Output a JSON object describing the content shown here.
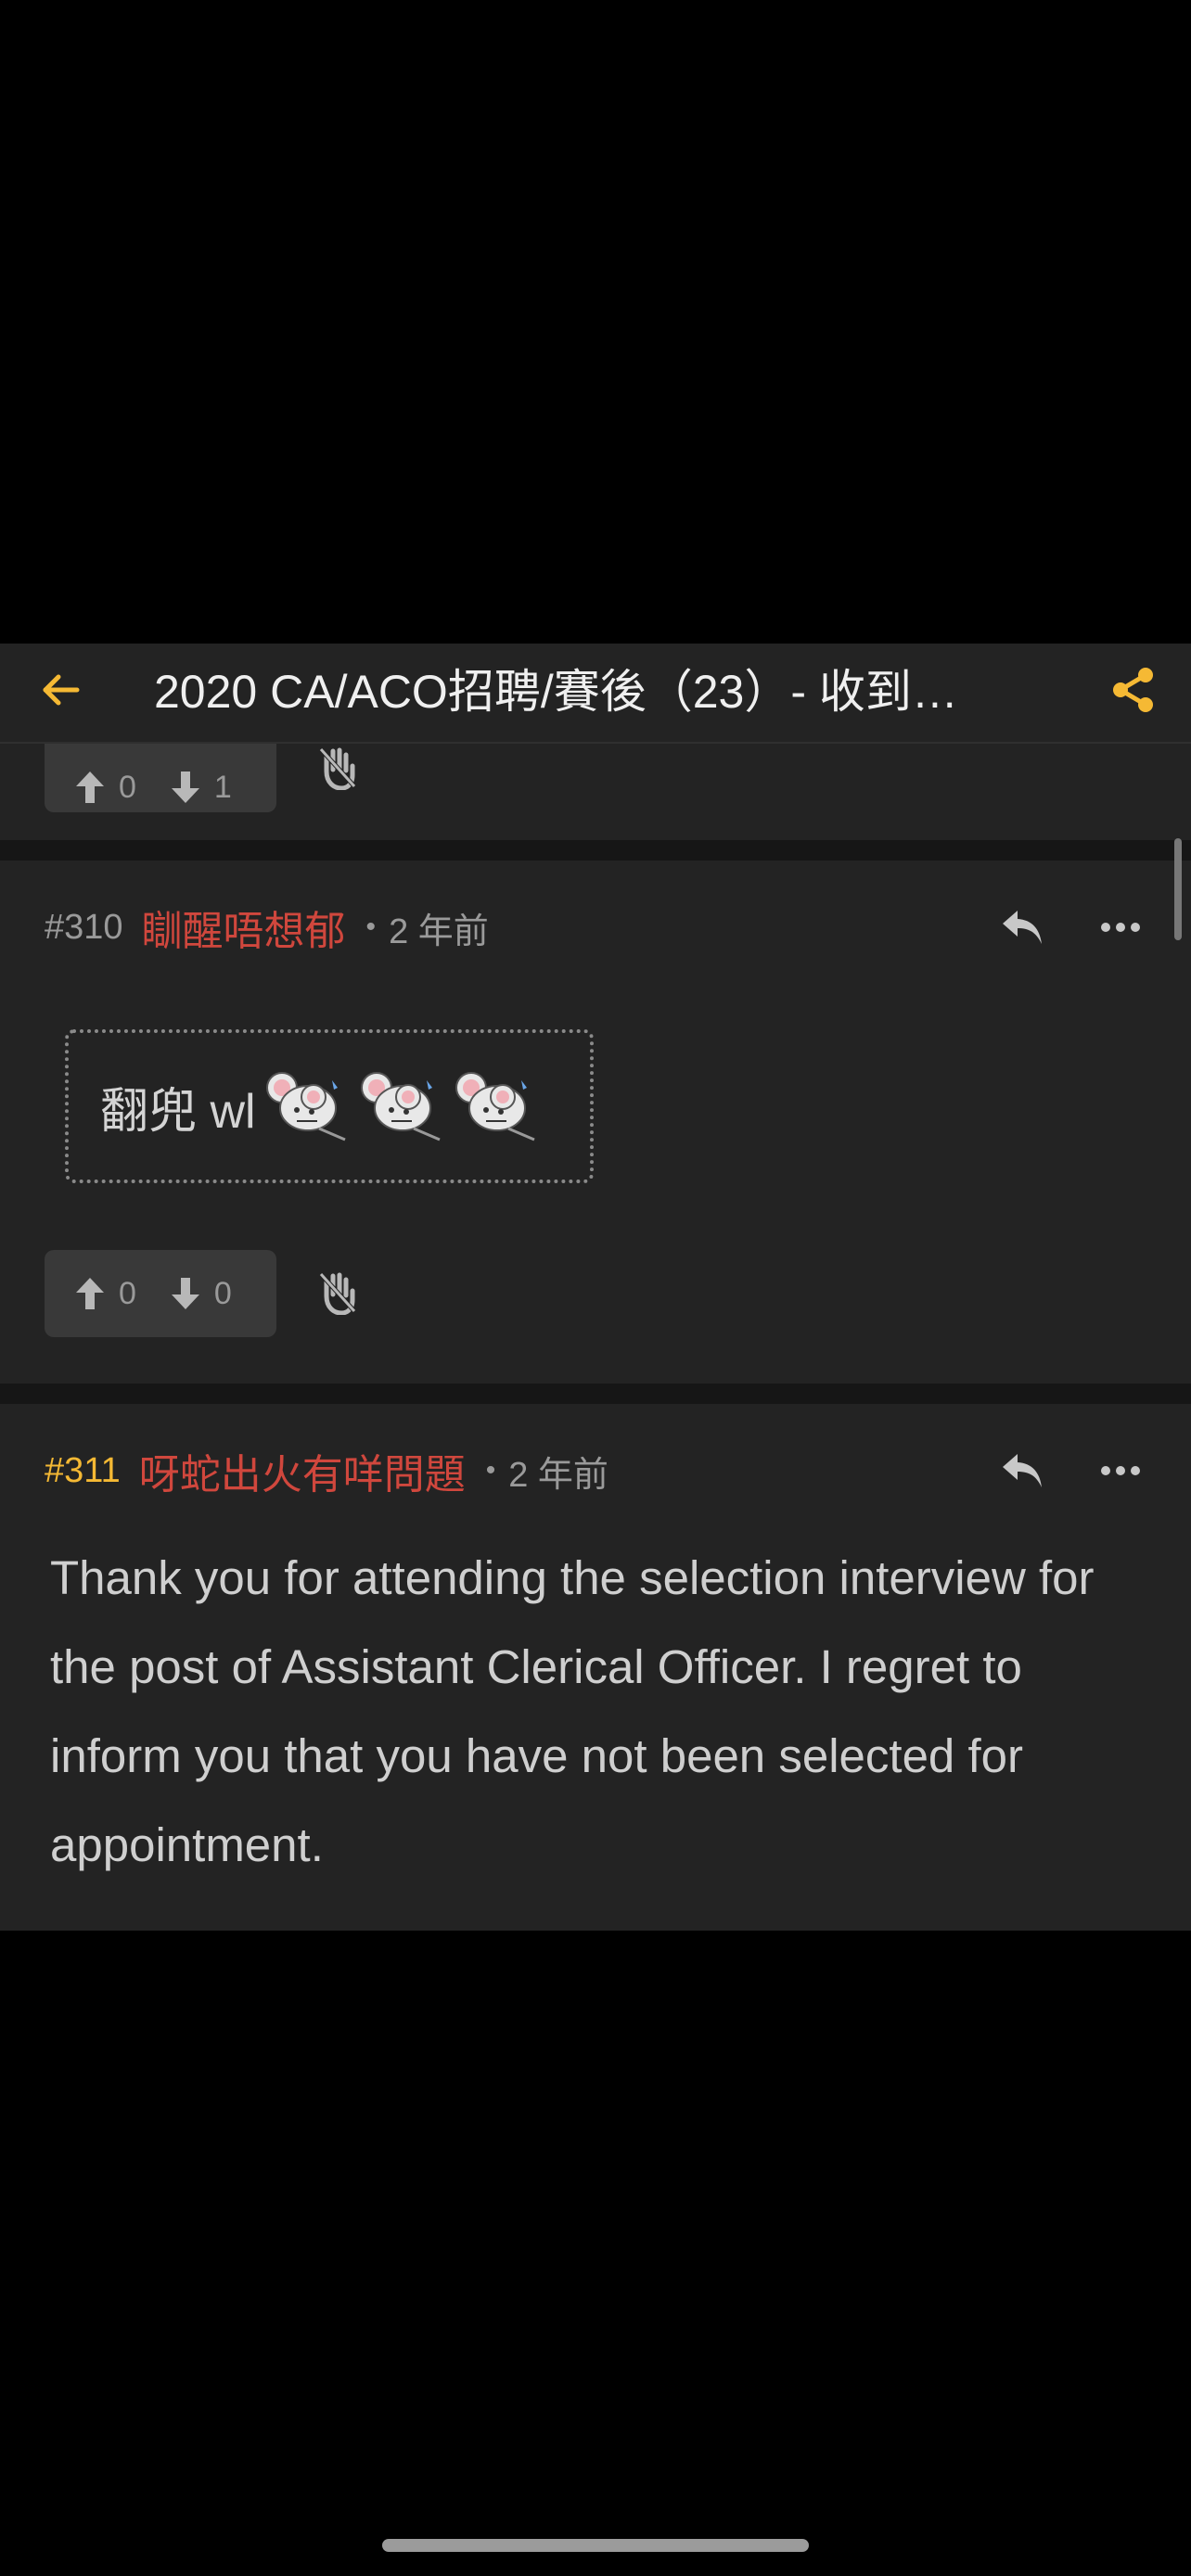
{
  "header": {
    "title": "2020 CA/ACO招聘/賽後（23）- 收到…",
    "accent_color": "#f5b934",
    "back_icon": "arrow-left-icon",
    "share_icon": "share-icon"
  },
  "previous_post_actions": {
    "upvotes": "0",
    "downvotes": "1"
  },
  "posts": [
    {
      "number": "#310",
      "username": "瞓醒唔想郁",
      "dot": "•",
      "time": "2 年前",
      "quote_text": "翻兜 wl",
      "emoji": "mouse-sticker",
      "upvotes": "0",
      "downvotes": "0"
    },
    {
      "number": "#311",
      "username": "呀蛇出火有咩問題",
      "dot": "•",
      "time": "2 年前",
      "body": "Thank you for attending the selection interview for the post of Assistant Clerical Officer. I regret to inform you that you have not been selected for appointment."
    }
  ],
  "colors": {
    "username": "#d0473d",
    "highlight_number": "#f5b934",
    "background": "#232323"
  }
}
